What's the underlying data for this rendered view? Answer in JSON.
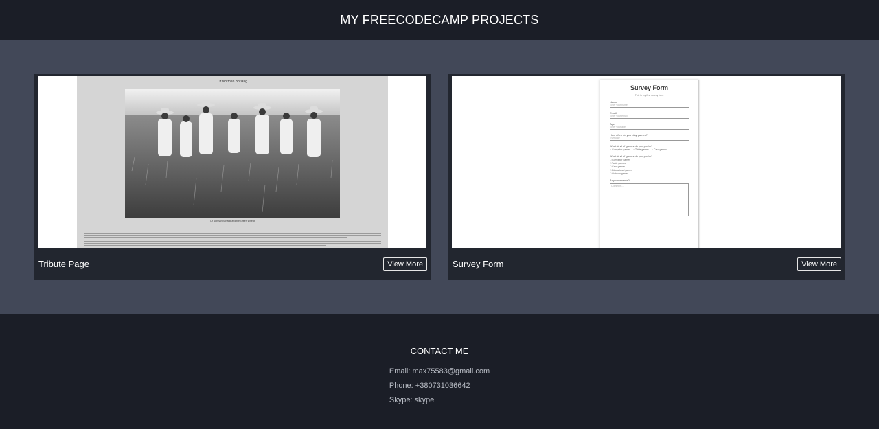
{
  "header": {
    "title": "MY FREECODECAMP PROJECTS"
  },
  "projects": [
    {
      "title": "Tribute Page",
      "button": "View More",
      "preview": {
        "heading": "Dr Norman Borlaug",
        "caption": "Dr Norman Borlaug and the Green Wheat",
        "image": "field-photo"
      }
    },
    {
      "title": "Survey Form",
      "button": "View More",
      "preview": {
        "heading": "Survey Form",
        "subheading": "This is my first survey form",
        "name_label": "Name",
        "name_placeholder": "Enter your name",
        "email_label": "Email",
        "email_placeholder": "Enter your email",
        "age_label": "Age",
        "age_placeholder": "Enter your age",
        "play_label": "How often do you play games?",
        "play_value": "Everyday",
        "kind_label": "What kind of games do you prefer?",
        "kind_options": [
          "Computer games",
          "Table games",
          "Card games"
        ],
        "kind2_label": "What kind of games do you prefer?",
        "kind2_options": [
          "Computer games",
          "Table games",
          "Card games",
          "Educational games",
          "Outdoor games"
        ],
        "comments_label": "Any comments?",
        "comments_placeholder": "Comment..."
      }
    }
  ],
  "contact": {
    "title": "CONTACT ME",
    "email": "Email: max75583@gmail.com",
    "phone": "Phone: +380731036642",
    "skype": "Skype: skype"
  },
  "colors": {
    "header_bg": "#1b1e27",
    "projects_bg": "#424858",
    "card_bg": "#22262f"
  }
}
